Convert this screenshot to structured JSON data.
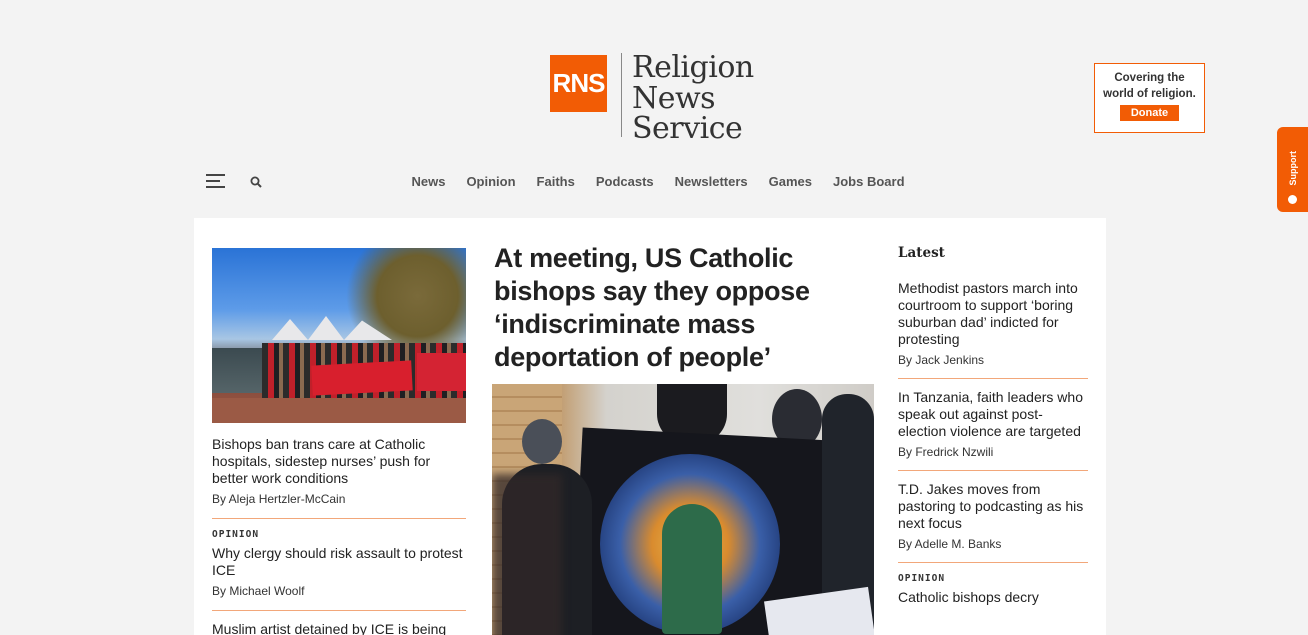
{
  "header": {
    "logo_mark": "RNS",
    "logo_lines": [
      "Religion",
      "News",
      "Service"
    ],
    "tagline_line1": "Covering the",
    "tagline_line2": "world of religion.",
    "donate_label": "Donate",
    "support_label": "Support"
  },
  "nav": {
    "items": [
      "News",
      "Opinion",
      "Faiths",
      "Podcasts",
      "Newsletters",
      "Games",
      "Jobs Board"
    ]
  },
  "left": {
    "stories": [
      {
        "kicker": "",
        "title": "Bishops ban trans care at Catholic hospitals, sidestep nurses’ push for better work conditions",
        "byline": "By Aleja Hertzler-McCain"
      },
      {
        "kicker": "OPINION",
        "title": "Why clergy should risk assault to protest ICE",
        "byline": "By Michael Woolf"
      },
      {
        "kicker": "",
        "title": "Muslim artist detained by ICE is being",
        "byline": ""
      }
    ]
  },
  "main": {
    "headline": "At meeting, US Catholic bishops say they oppose ‘indiscriminate mass deportation of people’"
  },
  "latest": {
    "heading": "Latest",
    "items": [
      {
        "kicker": "",
        "title": "Methodist pastors march into courtroom to support ‘boring suburban dad’ indicted for protesting",
        "byline": "By Jack Jenkins"
      },
      {
        "kicker": "",
        "title": "In Tanzania, faith leaders who speak out against post-election violence are targeted",
        "byline": "By Fredrick Nzwili"
      },
      {
        "kicker": "",
        "title": "T.D. Jakes moves from pastoring to podcasting as his next focus",
        "byline": "By Adelle M. Banks"
      },
      {
        "kicker": "OPINION",
        "title": "Catholic bishops decry",
        "byline": ""
      }
    ]
  },
  "colors": {
    "brand": "#f25c05",
    "divider": "#f2a77a"
  }
}
